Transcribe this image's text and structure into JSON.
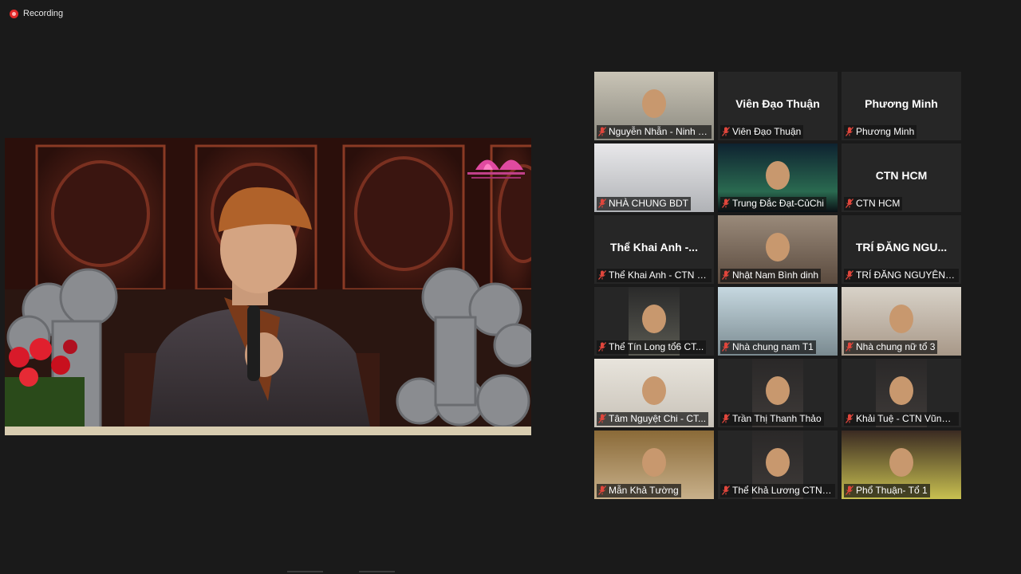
{
  "recording": {
    "label": "Recording"
  },
  "main_video": {
    "speaker_icon": "presenter-video"
  },
  "participants": [
    {
      "name": "Nguyễn Nhẫn - Ninh Th...",
      "video": true,
      "muted": true,
      "active": true
    },
    {
      "name": "Viên Đạo Thuận",
      "video": false,
      "muted": true,
      "display_name": "Viên Đạo Thuận"
    },
    {
      "name": "Phương Minh",
      "video": false,
      "muted": true,
      "display_name": "Phương Minh"
    },
    {
      "name": "NHÀ CHUNG BDT",
      "video": true,
      "muted": true
    },
    {
      "name": "Trung Đắc Đạt-CủChi",
      "video": true,
      "muted": true
    },
    {
      "name": "CTN HCM",
      "video": false,
      "muted": true,
      "display_name": "CTN HCM"
    },
    {
      "name": "Thể Khai Anh - CTN V...",
      "video": false,
      "muted": true,
      "display_name": "Thể Khai Anh -..."
    },
    {
      "name": "Nhật Nam Bình dinh",
      "video": true,
      "muted": true
    },
    {
      "name": "TRÍ ĐĂNG NGUYÊN. ...",
      "video": false,
      "muted": true,
      "display_name": "TRÍ ĐĂNG NGU..."
    },
    {
      "name": "Thể Tín Long  tổ6 CT...",
      "video": true,
      "muted": true
    },
    {
      "name": "Nhà chung nam T1",
      "video": true,
      "muted": true
    },
    {
      "name": "Nhà chung nữ tổ 3",
      "video": true,
      "muted": true
    },
    {
      "name": "Tâm Nguyệt Chi - CT...",
      "video": true,
      "muted": true
    },
    {
      "name": "Trần Thị Thanh Thảo",
      "video": true,
      "muted": true
    },
    {
      "name": "Khải Tuệ - CTN Vũng ...",
      "video": true,
      "muted": true
    },
    {
      "name": "Mẫn Khả Tường",
      "video": true,
      "muted": true
    },
    {
      "name": "Thể Khả Lương CTN-...",
      "video": true,
      "muted": true
    },
    {
      "name": "Phổ Thuận- Tổ 1",
      "video": true,
      "muted": true
    }
  ],
  "colors": {
    "active_border": "#b7d84d",
    "muted_icon": "#e0463c",
    "tile_bg": "#262626"
  }
}
